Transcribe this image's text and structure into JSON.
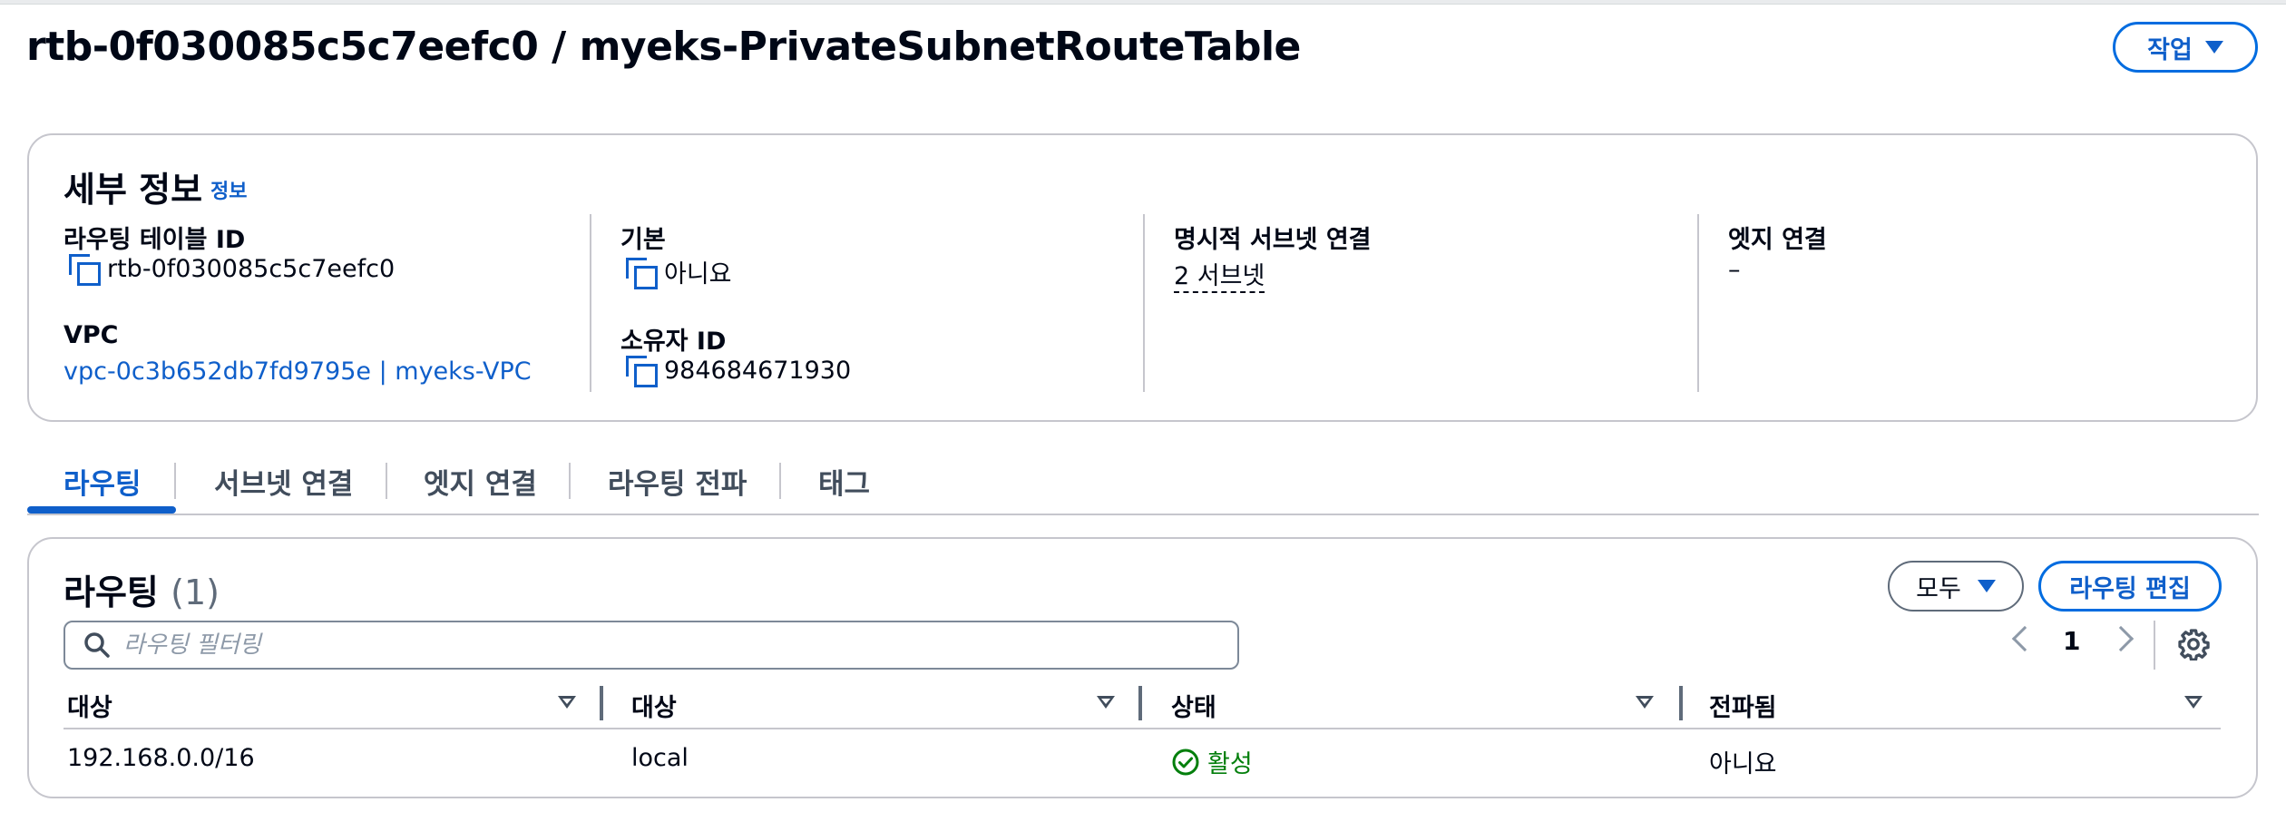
{
  "header": {
    "title": "rtb-0f030085c5c7eefc0 / myeks-PrivateSubnetRouteTable",
    "actions_label": "작업"
  },
  "details": {
    "title": "세부 정보",
    "info_link": "정보",
    "route_table_id_label": "라우팅 테이블 ID",
    "route_table_id": "rtb-0f030085c5c7eefc0",
    "vpc_label": "VPC",
    "vpc_value": "vpc-0c3b652db7fd9795e | myeks-VPC",
    "main_label": "기본",
    "main_value": "아니요",
    "owner_label": "소유자 ID",
    "owner_value": "984684671930",
    "explicit_subnet_label": "명시적 서브넷 연결",
    "explicit_subnet_value": "2 서브넷",
    "edge_label": "엣지 연결",
    "edge_value": "–"
  },
  "tabs": [
    {
      "label": "라우팅"
    },
    {
      "label": "서브넷 연결"
    },
    {
      "label": "엣지 연결"
    },
    {
      "label": "라우팅 전파"
    },
    {
      "label": "태그"
    }
  ],
  "routes": {
    "title": "라우팅",
    "count": "(1)",
    "filter_label": "모두",
    "edit_label": "라우팅 편집",
    "search_placeholder": "라우팅 필터링",
    "page": "1",
    "columns": [
      "대상",
      "대상",
      "상태",
      "전파됨"
    ],
    "rows": [
      {
        "destination": "192.168.0.0/16",
        "target": "local",
        "status": "활성",
        "propagated": "아니요"
      }
    ]
  },
  "colors": {
    "accent": "#0f5fca",
    "success": "#037f0c",
    "border": "#c6c6cd"
  }
}
